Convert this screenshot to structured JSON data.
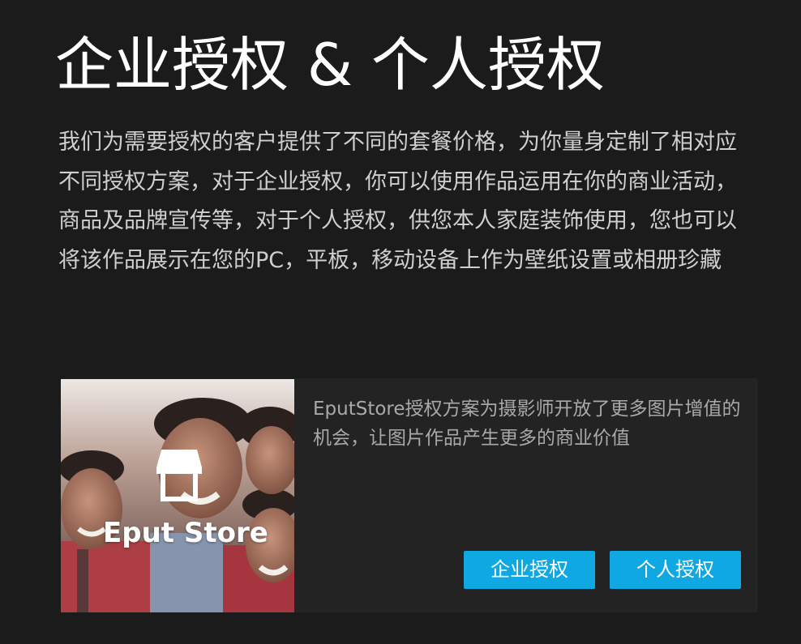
{
  "page": {
    "title": "企业授权 & 个人授权",
    "intro": "我们为需要授权的客户提供了不同的套餐价格，为你量身定制了相对应不同授权方案，对于企业授权，你可以使用作品运用在你的商业活动，商品及品牌宣传等，对于个人授权，供您本人家庭装饰使用，您也可以将该作品展示在您的PC，平板，移动设备上作为壁纸设置或相册珍藏"
  },
  "card": {
    "logo_text": "Eput Store",
    "logo_icon": "storefront-icon",
    "description": "EputStore授权方案为摄影师开放了更多图片增值的机会，让图片作品产生更多的商业价值",
    "buttons": {
      "enterprise_label": "企业授权",
      "personal_label": "个人授权"
    }
  },
  "colors": {
    "background": "#1b1b1b",
    "card_background": "#232323",
    "accent": "#10a8e3"
  }
}
